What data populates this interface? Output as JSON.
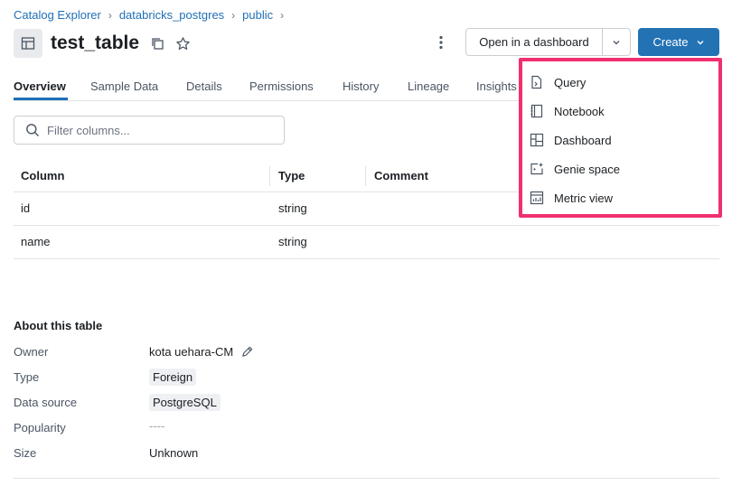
{
  "breadcrumb": [
    "Catalog Explorer",
    "databricks_postgres",
    "public"
  ],
  "breadcrumb_separator": "›",
  "title": "test_table",
  "toolbar": {
    "open_dashboard_label": "Open in a dashboard",
    "create_label": "Create"
  },
  "tabs": [
    "Overview",
    "Sample Data",
    "Details",
    "Permissions",
    "History",
    "Lineage",
    "Insights"
  ],
  "filter": {
    "placeholder": "Filter columns..."
  },
  "columns_table": {
    "headers": [
      "Column",
      "Type",
      "Comment"
    ],
    "rows": [
      {
        "column": "id",
        "type": "string",
        "comment": ""
      },
      {
        "column": "name",
        "type": "string",
        "comment": ""
      }
    ]
  },
  "about": {
    "title": "About this table",
    "owner_label": "Owner",
    "owner_value": "kota uehara-CM",
    "type_label": "Type",
    "type_value": "Foreign",
    "source_label": "Data source",
    "source_value": "PostgreSQL",
    "popularity_label": "Popularity",
    "popularity_value": "----",
    "size_label": "Size",
    "size_value": "Unknown"
  },
  "create_menu": {
    "items": [
      {
        "label": "Query",
        "icon": "query-icon"
      },
      {
        "label": "Notebook",
        "icon": "notebook-icon"
      },
      {
        "label": "Dashboard",
        "icon": "dashboard-icon"
      },
      {
        "label": "Genie space",
        "icon": "genie-space-icon"
      },
      {
        "label": "Metric view",
        "icon": "metric-view-icon"
      }
    ]
  },
  "colors": {
    "primary": "#2272b4",
    "link": "#1f6fb6",
    "highlight": "#f0306e"
  }
}
